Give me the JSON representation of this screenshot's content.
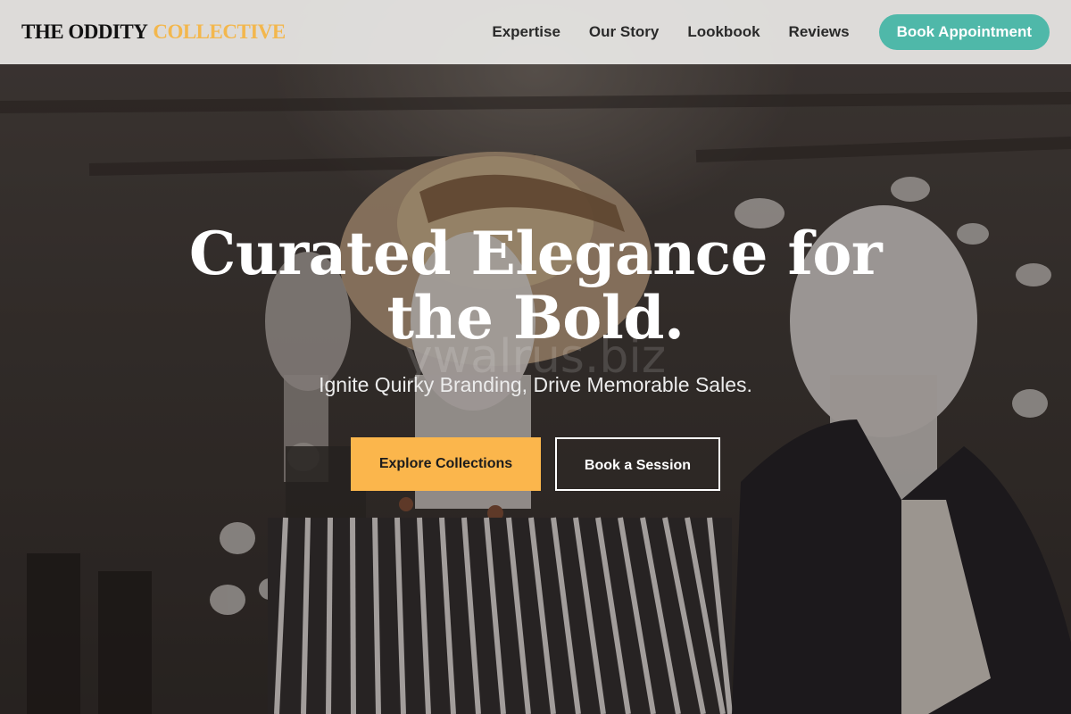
{
  "brand": {
    "name_part1": "THE ODDITY",
    "name_part2": "COLLECTIVE"
  },
  "nav": {
    "items": [
      {
        "label": "Expertise"
      },
      {
        "label": "Our Story"
      },
      {
        "label": "Lookbook"
      },
      {
        "label": "Reviews"
      }
    ],
    "cta_label": "Book Appointment"
  },
  "hero": {
    "title": "Curated Elegance for the Bold.",
    "subtitle": "Ignite Quirky Branding, Drive Memorable Sales.",
    "watermark": "ywalrus.biz",
    "primary_button": "Explore Collections",
    "secondary_button": "Book a Session",
    "background_image": "mannequins-in-boutique-photo"
  },
  "colors": {
    "accent_gold": "#f3b74d",
    "button_gold": "#fbb64c",
    "teal": "#4fb8a9"
  }
}
